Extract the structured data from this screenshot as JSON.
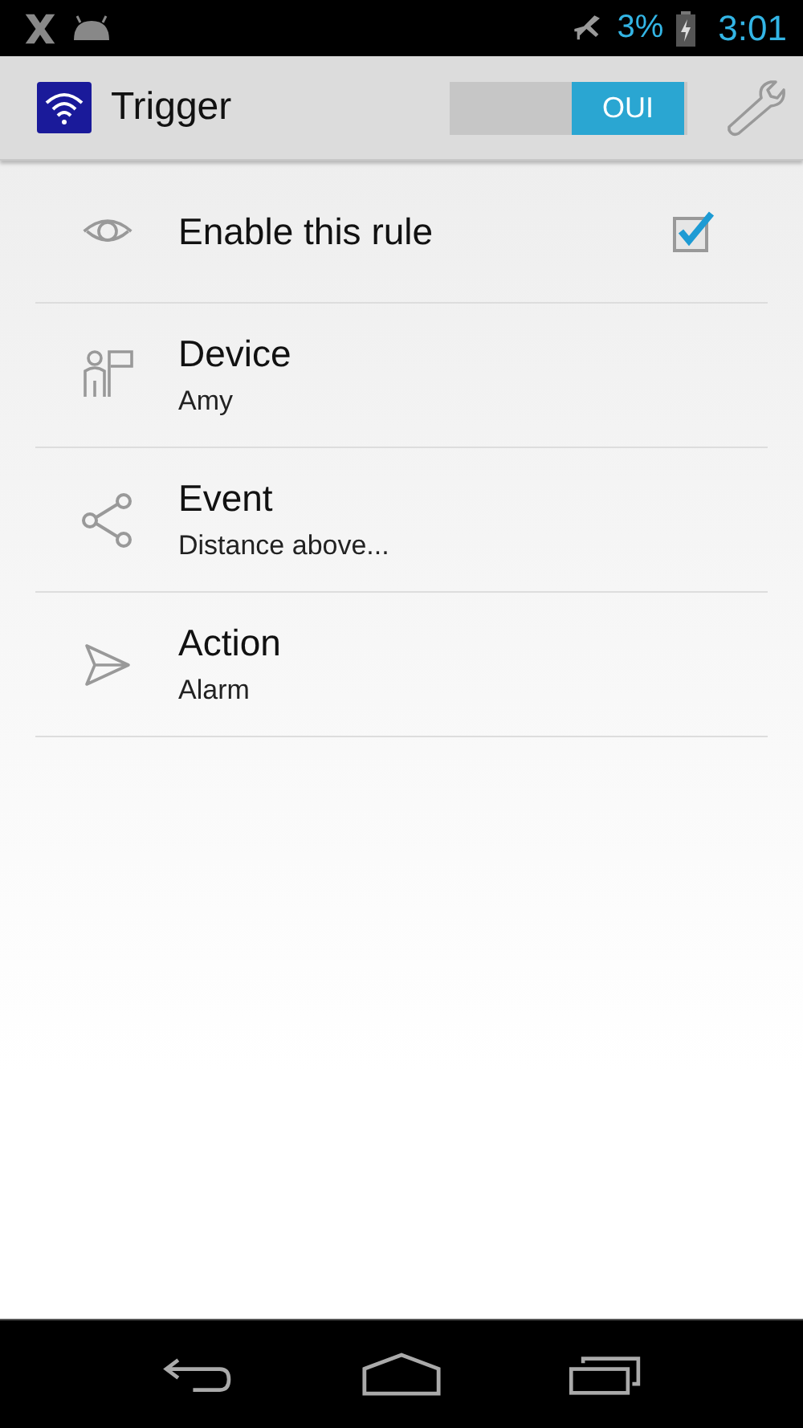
{
  "status_bar": {
    "battery": "3%",
    "time": "3:01"
  },
  "action_bar": {
    "title": "Trigger",
    "switch": {
      "label": "OUI",
      "on": true
    }
  },
  "rows": [
    {
      "kind": "checkbox",
      "title": "Enable this rule",
      "checked": true
    },
    {
      "kind": "detail",
      "title": "Device",
      "subtitle": "Amy"
    },
    {
      "kind": "detail",
      "title": "Event",
      "subtitle": "Distance above..."
    },
    {
      "kind": "detail",
      "title": "Action",
      "subtitle": "Alarm"
    }
  ]
}
